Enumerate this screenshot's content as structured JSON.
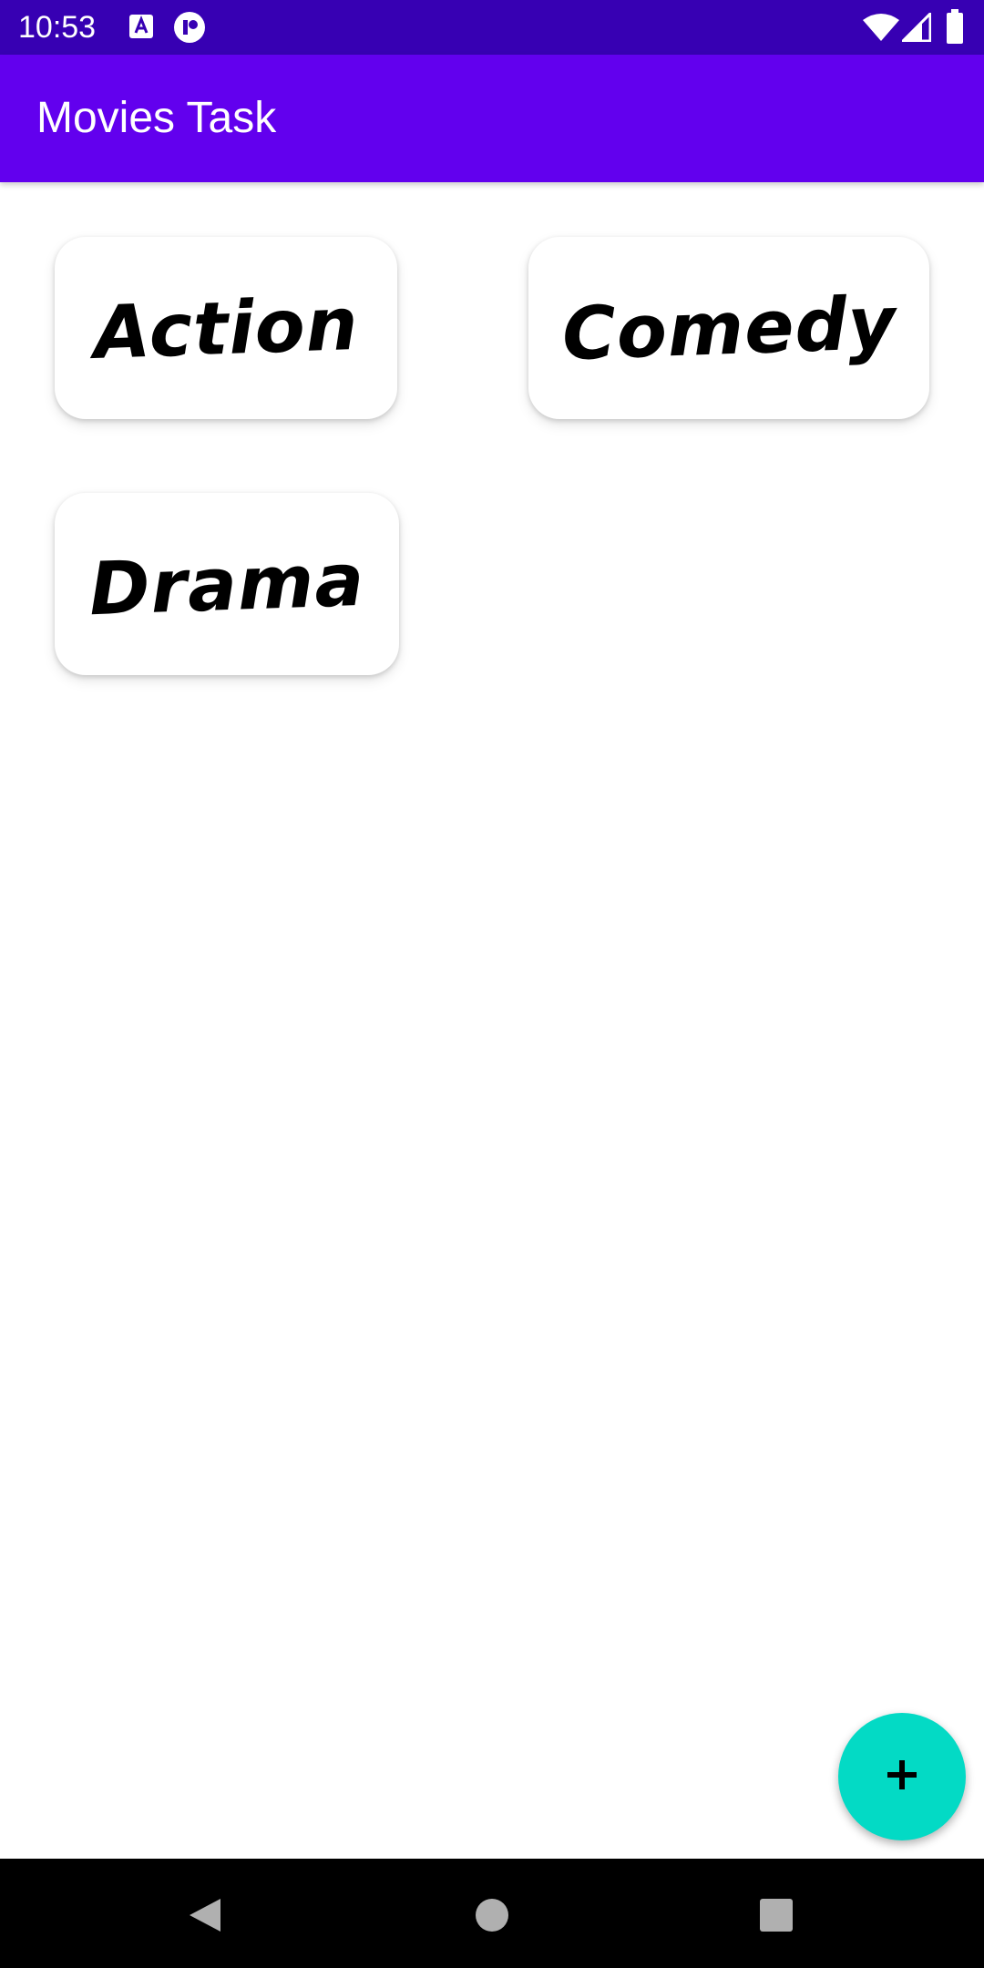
{
  "status_bar": {
    "time": "10:53",
    "left_icons": [
      "text-accessibility-icon",
      "app-notification-icon"
    ],
    "right_icons": [
      "wifi-icon",
      "cell-signal-icon",
      "battery-icon"
    ]
  },
  "app_bar": {
    "title": "Movies Task"
  },
  "genres": [
    {
      "label": "Action"
    },
    {
      "label": "Comedy"
    },
    {
      "label": "Drama"
    }
  ],
  "fab": {
    "icon": "plus-icon"
  },
  "nav_bar": {
    "buttons": [
      "back-icon",
      "home-icon",
      "recents-icon"
    ]
  },
  "colors": {
    "status_bar": "#3700b3",
    "app_bar": "#6200ee",
    "fab": "#03dac5",
    "nav_bar": "#000000"
  }
}
